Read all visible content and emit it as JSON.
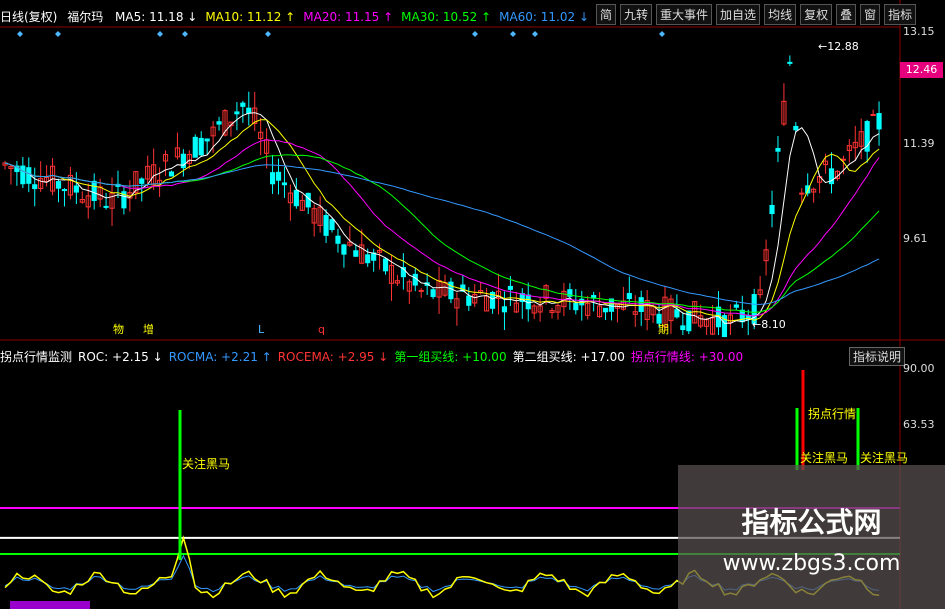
{
  "header": {
    "title": "日线(复权)",
    "stock": "福尔玛",
    "ma_items": [
      {
        "label": "MA5:",
        "value": "11.18",
        "arrow": "↓",
        "color": "#ffffff"
      },
      {
        "label": "MA10:",
        "value": "11.12",
        "arrow": "↑",
        "color": "#ffff00"
      },
      {
        "label": "MA20:",
        "value": "11.15",
        "arrow": "↑",
        "color": "#ff00ff"
      },
      {
        "label": "MA30:",
        "value": "10.52",
        "arrow": "↑",
        "color": "#00ff00"
      },
      {
        "label": "MA60:",
        "value": "11.02",
        "arrow": "↓",
        "color": "#3399ff"
      }
    ]
  },
  "toolbar": {
    "buttons": [
      "简",
      "九转",
      "重大事件",
      "加自选",
      "均线",
      "复权",
      "叠",
      "窗",
      "指标"
    ],
    "explain_button": "指标说明"
  },
  "price_axis": [
    "13.15",
    "12.46",
    "11.39",
    "9.61"
  ],
  "current_price": "12.46",
  "annotations": {
    "high_label": "12.88",
    "low_label": "8.10",
    "markers": [
      "物",
      "增",
      "L",
      "q",
      "期"
    ]
  },
  "indicator": {
    "header_items": [
      {
        "label": "拐点行情监测",
        "value": "",
        "color": "#ffffff"
      },
      {
        "label": "ROC:",
        "value": "+2.15",
        "arrow": "↓",
        "color": "#ffffff"
      },
      {
        "label": "ROCMA:",
        "value": "+2.21",
        "arrow": "↑",
        "color": "#3399ff"
      },
      {
        "label": "ROCEMA:",
        "value": "+2.95",
        "arrow": "↓",
        "color": "#ff3333"
      },
      {
        "label": "第一组买线:",
        "value": "+10.00",
        "color": "#00ff00"
      },
      {
        "label": "第二组买线:",
        "value": "+17.00",
        "color": "#ffffff"
      },
      {
        "label": "拐点行情线:",
        "value": "+30.00",
        "color": "#ff00ff"
      }
    ],
    "axis": [
      "90.00",
      "63.53"
    ],
    "signals": [
      "关注黑马",
      "拐点行情",
      "关注黑马",
      "关注黑马"
    ]
  },
  "watermark": {
    "line1": "指标公式网",
    "line2": "www.zbgs3.com"
  },
  "chart_data": {
    "type": "candlestick",
    "price_range": [
      8.1,
      13.15
    ],
    "highest": 12.88,
    "lowest": 8.1,
    "colors": {
      "up": "#ff3333",
      "down": "#00ffff"
    },
    "lines": [
      {
        "name": "MA5",
        "color": "#ffffff"
      },
      {
        "name": "MA10",
        "color": "#ffff00"
      },
      {
        "name": "MA20",
        "color": "#ff00ff"
      },
      {
        "name": "MA30",
        "color": "#00ff00"
      },
      {
        "name": "MA60",
        "color": "#3399ff"
      }
    ],
    "indicator_lines": [
      {
        "name": "第一组买线",
        "value": 10.0,
        "color": "#00ff00"
      },
      {
        "name": "第二组买线",
        "value": 17.0,
        "color": "#ffffff"
      },
      {
        "name": "拐点行情线",
        "value": 30.0,
        "color": "#ff00ff"
      }
    ],
    "indicator_range": [
      -10,
      90
    ]
  }
}
